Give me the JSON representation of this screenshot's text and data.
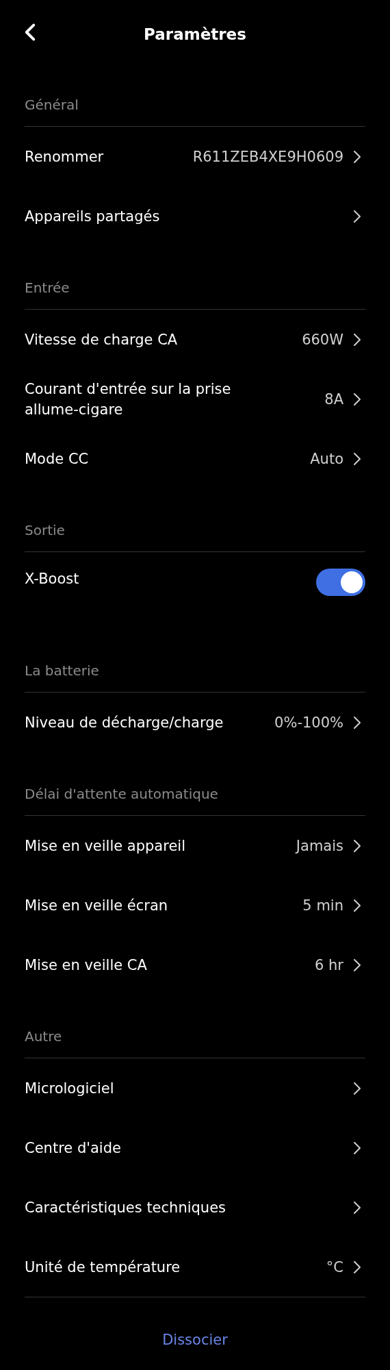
{
  "header": {
    "title": "Paramètres"
  },
  "sections": [
    {
      "title": "Général",
      "rows": [
        {
          "kind": "link",
          "label": "Renommer",
          "value": "R611ZEB4XE9H0609"
        },
        {
          "kind": "link",
          "label": "Appareils partagés"
        }
      ]
    },
    {
      "title": "Entrée",
      "rows": [
        {
          "kind": "link",
          "label": "Vitesse de charge CA",
          "value": "660W"
        },
        {
          "kind": "link",
          "label": "Courant d'entrée sur la prise allume-cigare",
          "value": "8A"
        },
        {
          "kind": "link",
          "label": "Mode CC",
          "value": "Auto"
        }
      ]
    },
    {
      "title": "Sortie",
      "rows": [
        {
          "kind": "toggle",
          "label": "X-Boost",
          "on": true
        }
      ]
    },
    {
      "title": "La batterie",
      "rows": [
        {
          "kind": "link",
          "label": "Niveau de décharge/charge",
          "value": "0%-100%"
        }
      ]
    },
    {
      "title": "Délai d'attente automatique",
      "rows": [
        {
          "kind": "link",
          "label": "Mise en veille appareil",
          "value": "Jamais"
        },
        {
          "kind": "link",
          "label": "Mise en veille écran",
          "value": "5 min"
        },
        {
          "kind": "link",
          "label": "Mise en veille CA",
          "value": "6 hr"
        }
      ]
    },
    {
      "title": "Autre",
      "rows": [
        {
          "kind": "link",
          "label": "Micrologiciel"
        },
        {
          "kind": "link",
          "label": "Centre d'aide"
        },
        {
          "kind": "link",
          "label": "Caractéristiques techniques"
        },
        {
          "kind": "link",
          "label": "Unité de température",
          "value": "°C"
        }
      ]
    }
  ],
  "footer_link": "Dissocier"
}
